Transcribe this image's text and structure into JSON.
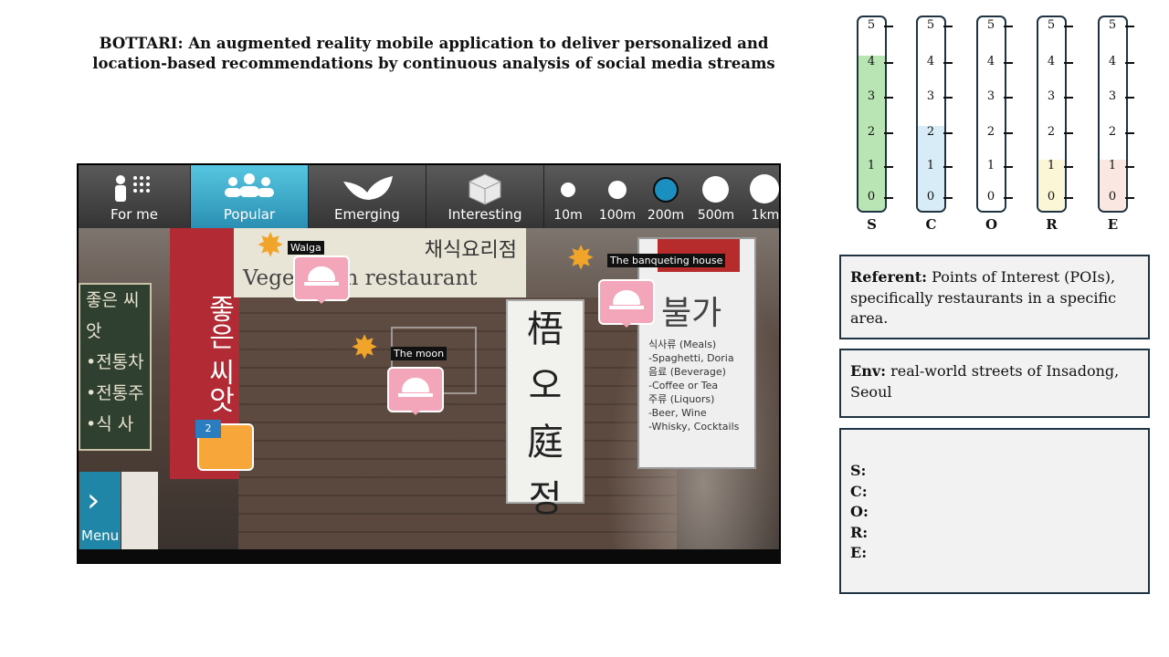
{
  "title_line1": "BOTTARI: An augmented reality mobile application to deliver personalized and",
  "title_line2": "location-based recommendations by continuous analysis of social media streams",
  "app": {
    "tabs": [
      {
        "label": "For me",
        "icon": "person-grid-icon"
      },
      {
        "label": "Popular",
        "icon": "people-icon",
        "active": true
      },
      {
        "label": "Emerging",
        "icon": "leaf-icon"
      },
      {
        "label": "Interesting",
        "icon": "cube-icon"
      }
    ],
    "distances": [
      "10m",
      "100m",
      "200m",
      "500m",
      "1km"
    ],
    "selected_distance": "200m",
    "accent": "#2aa6d3",
    "scene": {
      "banner_korean": "채식요리점",
      "banner_english": "Vegetarian restaurant",
      "red_sign_text": "좋은 씨앗",
      "green_sign_lines": [
        "좋은 씨앗",
        "•전통차",
        "•전통주",
        "•식 사"
      ],
      "white_sign_text": "梧 오 庭 정",
      "menu_sign_big": "불가",
      "menu_sign_lines": [
        "식사류 (Meals)",
        "-Spaghetti, Doria",
        "음료 (Beverage)",
        "-Coffee or Tea",
        "주류 (Liquors)",
        "-Beer, Wine",
        "-Whisky, Cocktails"
      ]
    },
    "pois": [
      {
        "label": "Walga"
      },
      {
        "label": "The banqueting house"
      },
      {
        "label": "The moon"
      }
    ],
    "chat_badge": "2",
    "menu_label": "Menu"
  },
  "scales": {
    "ticks": [
      "5",
      "4",
      "3",
      "2",
      "1",
      "0"
    ],
    "items": [
      {
        "letter": "S",
        "level": 4,
        "color": "#b9e4b3"
      },
      {
        "letter": "C",
        "level": 2,
        "color": "#d7ecf7"
      },
      {
        "letter": "O",
        "level": 0,
        "color": "#ffffff"
      },
      {
        "letter": "R",
        "level": 1,
        "color": "#fbf6d6"
      },
      {
        "letter": "E",
        "level": 1,
        "color": "#fbe7e2"
      }
    ]
  },
  "referent": {
    "label": "Referent:",
    "text": "Points of Interest (POIs), specifically restaurants in a specific area."
  },
  "env": {
    "label": "Env:",
    "text": "real-world streets of Insadong, Seoul"
  },
  "scores": [
    "S:",
    "C:",
    "O:",
    "R:",
    "E:"
  ]
}
